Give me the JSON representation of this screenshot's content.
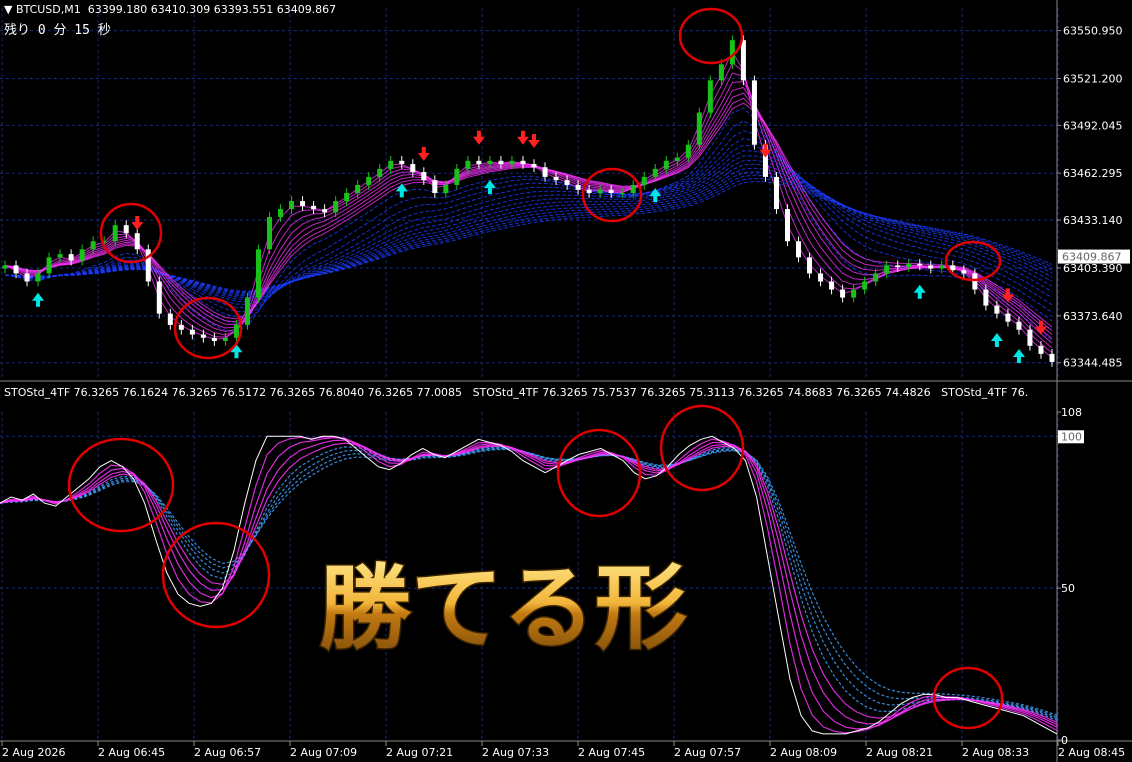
{
  "header": {
    "symbol": "▼ BTCUSD,M1",
    "ohlc": "63399.180 63410.309 63393.551 63409.867",
    "timer": "残り 0 分 15 秒"
  },
  "indicator_header": [
    "STOStd_4TF 76.3265 76.1624 76.3265 76.5172 76.3265 76.8040 76.3265 77.0085",
    "STOStd_4TF 76.3265 75.7537 76.3265 75.3113 76.3265 74.8683 76.3265 74.4826",
    "STOStd_4TF 76."
  ],
  "overlay_text": "勝てる形",
  "colors": {
    "bull": "#19c219",
    "bear": "#ffffff",
    "ribbon_blue": "#1a3cff",
    "ribbon_magenta": "#ff33ff",
    "arrow_up": "#00e5e5",
    "arrow_down": "#ff2020",
    "circle": "#e00000",
    "grid": "#1a2a7a",
    "overlay_gold": "#f2b53a"
  },
  "chart_data": [
    {
      "type": "candlestick",
      "title": "BTCUSD,M1",
      "price_ticks": [
        "63550.950",
        "63521.200",
        "63492.045",
        "63462.295",
        "63433.140",
        "63403.390",
        "63373.640",
        "63344.485"
      ],
      "price_tick_values": [
        63550.95,
        63521.2,
        63492.045,
        63462.295,
        63433.14,
        63403.39,
        63373.64,
        63344.485
      ],
      "current_price": "63409.867",
      "ylim": [
        63335,
        63565
      ],
      "close_path": [
        63405,
        63400,
        63395,
        63400,
        63410,
        63412,
        63408,
        63415,
        63420,
        63420,
        63430,
        63425,
        63415,
        63395,
        63375,
        63368,
        63365,
        63362,
        63360,
        63358,
        63360,
        63368,
        63385,
        63415,
        63435,
        63440,
        63445,
        63442,
        63440,
        63438,
        63445,
        63450,
        63455,
        63460,
        63465,
        63470,
        63468,
        63463,
        63458,
        63450,
        63455,
        63465,
        63470,
        63468,
        63470,
        63468,
        63470,
        63468,
        63466,
        63460,
        63458,
        63455,
        63452,
        63450,
        63452,
        63450,
        63450,
        63455,
        63460,
        63465,
        63470,
        63472,
        63480,
        63500,
        63520,
        63530,
        63545,
        63520,
        63480,
        63460,
        63440,
        63420,
        63410,
        63400,
        63395,
        63390,
        63385,
        63390,
        63395,
        63400,
        63405,
        63404,
        63406,
        63405,
        63403,
        63405,
        63402,
        63400,
        63390,
        63380,
        63375,
        63370,
        63365,
        63355,
        63350,
        63345
      ],
      "arrows_up_at": [
        3,
        21,
        36,
        44,
        59,
        83,
        90,
        92
      ],
      "arrows_down_at": [
        12,
        38,
        43,
        47,
        48,
        69,
        91,
        94
      ]
    },
    {
      "type": "line",
      "title": "STOStd_4TF",
      "ylim": [
        0,
        108
      ],
      "y_ticks": [
        "108",
        "100",
        "50",
        "0"
      ],
      "y_tick_values": [
        108,
        100,
        50,
        0
      ],
      "x_ticks": [
        "2 Aug 2026",
        "2 Aug 06:45",
        "2 Aug 06:57",
        "2 Aug 07:09",
        "2 Aug 07:21",
        "2 Aug 07:33",
        "2 Aug 07:45",
        "2 Aug 07:57",
        "2 Aug 08:09",
        "2 Aug 08:21",
        "2 Aug 08:33",
        "2 Aug 08:45"
      ],
      "main_line": [
        78,
        80,
        79,
        81,
        78,
        77,
        80,
        83,
        86,
        90,
        92,
        90,
        86,
        78,
        66,
        55,
        48,
        45,
        44,
        45,
        50,
        62,
        78,
        92,
        100,
        100,
        100,
        100,
        99,
        100,
        100,
        99,
        96,
        93,
        90,
        89,
        91,
        94,
        96,
        94,
        93,
        95,
        97,
        99,
        98,
        97,
        95,
        92,
        90,
        88,
        90,
        92,
        94,
        95,
        96,
        94,
        92,
        88,
        86,
        87,
        90,
        94,
        97,
        99,
        100,
        98,
        96,
        92,
        80,
        60,
        40,
        20,
        8,
        3,
        2,
        2,
        2,
        3,
        4,
        6,
        9,
        12,
        14,
        15,
        15,
        14,
        14,
        13,
        12,
        11,
        10,
        9,
        8,
        6,
        4,
        2
      ],
      "ribbon_levels": 8
    }
  ]
}
